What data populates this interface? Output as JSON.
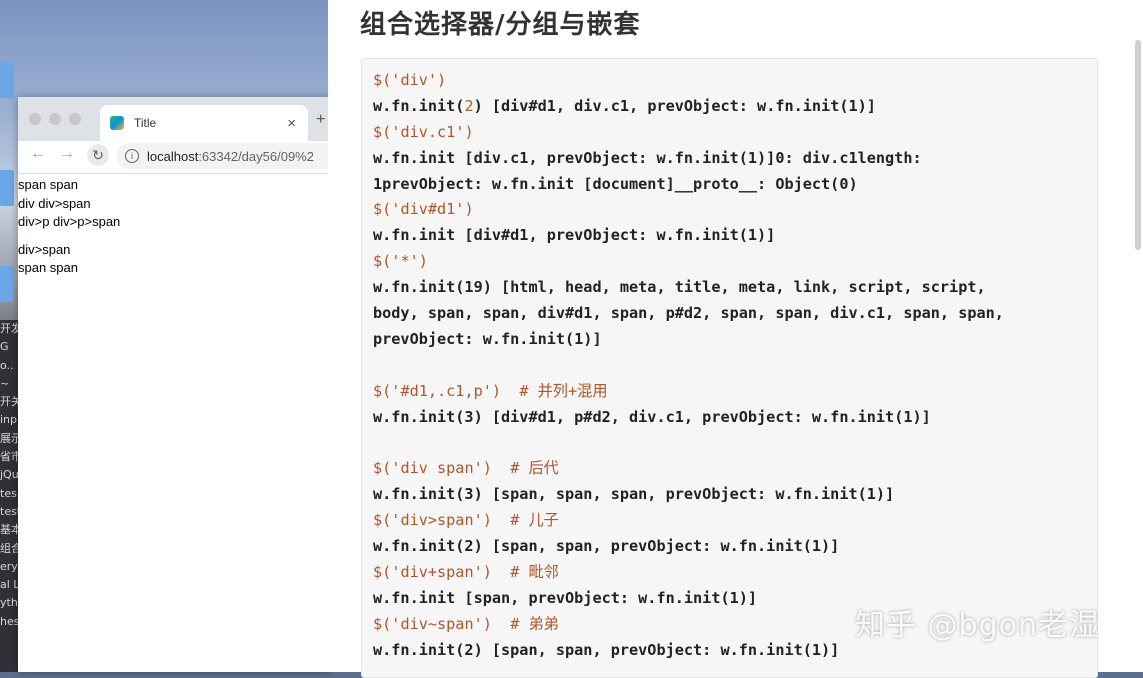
{
  "desktop": {
    "sidebar_fragments": [
      "开发",
      "G",
      "o..",
      "~",
      "开关",
      "inp",
      "展示",
      "省市",
      "jQu",
      "tes",
      "test",
      "基本",
      "组合",
      "ery",
      "al L",
      "yth",
      "hes"
    ]
  },
  "browser": {
    "tab_title": "Title",
    "tab_close": "×",
    "new_tab": "+",
    "url_host": "localhost",
    "url_rest": ":63342/day56/09%2",
    "page_lines": [
      "span span",
      "div div>span",
      "div>p div>p>span",
      "div>span",
      "span span"
    ]
  },
  "slide": {
    "title": "组合选择器/分组与嵌套",
    "watermark": "知乎 @bgon老湿",
    "code_lines": [
      {
        "dol": "$",
        "str": "('div')",
        "rest": "",
        "cm": ""
      },
      {
        "plain": "w.fn.init(",
        "num": "2",
        "tail": ") [div#d1, div.c1, prevObject: w.fn.init(1)]"
      },
      {
        "dol": "$",
        "str": "('div.c1')",
        "rest": "",
        "cm": ""
      },
      {
        "plain": "w.fn.init [div.c1, prevObject: w.fn.init(1)]0: div.c1length:",
        "num": "",
        "tail": ""
      },
      {
        "plain": "1prevObject: w.fn.init [document]__proto__: Object(0)",
        "num": "",
        "tail": ""
      },
      {
        "dol": "$",
        "str": "('div#d1')",
        "rest": "",
        "cm": ""
      },
      {
        "plain": "w.fn.init [div#d1, prevObject: w.fn.init(1)]",
        "num": "",
        "tail": ""
      },
      {
        "dol": "$",
        "str": "('*')",
        "rest": "",
        "cm": ""
      },
      {
        "plain": "w.fn.init(19) [html, head, meta, title, meta, link, script, script,",
        "num": "",
        "tail": ""
      },
      {
        "plain": "body, span, span, div#d1, span, p#d2, span, span, div.c1, span, span,",
        "num": "",
        "tail": ""
      },
      {
        "plain": "prevObject: w.fn.init(1)]",
        "num": "",
        "tail": ""
      },
      {
        "blank": true
      },
      {
        "dol": "$",
        "str": "('#d1,.c1,p')",
        "rest": "  ",
        "cm": "# 并列+混用"
      },
      {
        "plain": "w.fn.init(3) [div#d1, p#d2, div.c1, prevObject: w.fn.init(1)]",
        "num": "",
        "tail": ""
      },
      {
        "blank": true
      },
      {
        "dol": "$",
        "str": "('div span')",
        "rest": "  ",
        "cm": "# 后代"
      },
      {
        "plain": "w.fn.init(3) [span, span, span, prevObject: w.fn.init(1)]",
        "num": "",
        "tail": ""
      },
      {
        "dol": "$",
        "str": "('div>span')",
        "rest": "  ",
        "cm": "# 儿子"
      },
      {
        "plain": "w.fn.init(2) [span, span, prevObject: w.fn.init(1)]",
        "num": "",
        "tail": ""
      },
      {
        "dol": "$",
        "str": "('div+span')",
        "rest": "  ",
        "cm": "# 毗邻"
      },
      {
        "plain": "w.fn.init [span, prevObject: w.fn.init(1)]",
        "num": "",
        "tail": ""
      },
      {
        "dol": "$",
        "str": "('div~span')",
        "rest": "  ",
        "cm": "# 弟弟"
      },
      {
        "plain": "w.fn.init(2) [span, span, prevObject: w.fn.init(1)]",
        "num": "",
        "tail": ""
      }
    ]
  },
  "colors": {
    "string": "#b0562b",
    "code_bg": "#f6f6f6",
    "tab_bar": "#dee1e6"
  }
}
